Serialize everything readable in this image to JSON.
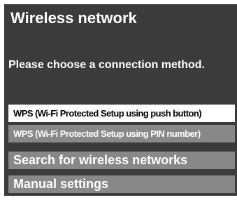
{
  "dialog": {
    "title": "Wireless network",
    "prompt": "Please choose a connection method."
  },
  "options": [
    {
      "label": "WPS (Wi-Fi Protected Setup using push button)",
      "selected": true
    },
    {
      "label": "WPS (Wi-Fi Protected Setup using PIN number)",
      "selected": false
    },
    {
      "label": "Search for wireless networks",
      "selected": false
    },
    {
      "label": "Manual settings",
      "selected": false
    }
  ],
  "colors": {
    "background": "#3b3b3b",
    "option_normal": "#888888",
    "option_selected": "#ffffff",
    "text_light": "#ffffff",
    "text_dark": "#000000"
  }
}
